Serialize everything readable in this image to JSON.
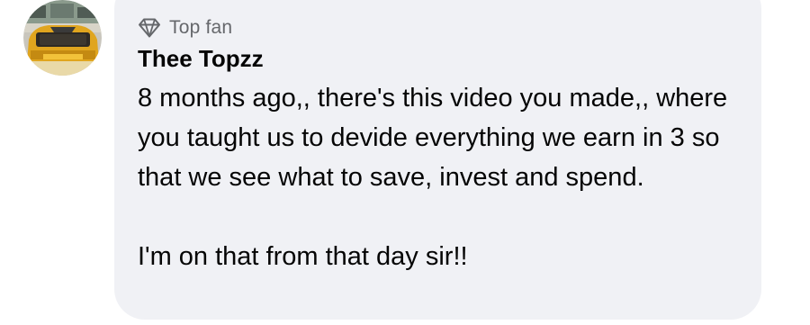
{
  "comment": {
    "badge": {
      "icon": "diamond-icon",
      "label": "Top fan",
      "color": "#65676b"
    },
    "author": "Thee Topzz",
    "paragraphs": [
      "8 months ago,, there's this video you made,, where you taught us to devide everything we earn in 3 so that we see what to save, invest and spend.",
      "I'm on that from that day sir!!"
    ],
    "bubble_color": "#f0f1f5",
    "text_color": "#050505"
  }
}
